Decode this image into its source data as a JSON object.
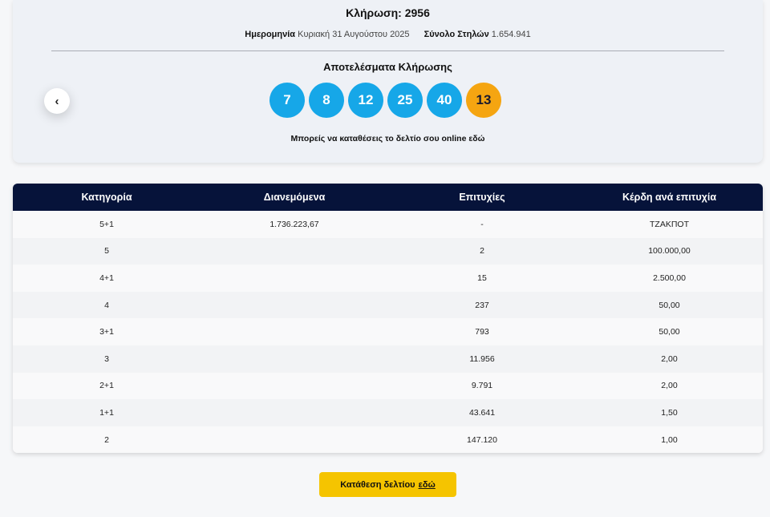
{
  "draw": {
    "title": "Κλήρωση: 2956",
    "date_label": "Ημερομηνία",
    "date_value": "Κυριακή 31 Αυγούστου 2025",
    "columns_label": "Σύνολο Στηλών",
    "columns_value": "1.654.941",
    "results_title": "Αποτελέσματα Κλήρωσης",
    "numbers": [
      "7",
      "8",
      "12",
      "25",
      "40"
    ],
    "joker": "13",
    "online_note": "Μπορείς να καταθέσεις το δελτίο σου online εδώ",
    "prev_icon": "chevron-left-icon",
    "prev_glyph": "‹"
  },
  "colors": {
    "ball": "#16a7e8",
    "joker": "#f5a511",
    "header": "#06133a",
    "button": "#f5c400"
  },
  "table": {
    "headers": [
      "Κατηγορία",
      "Διανεμόμενα",
      "Επιτυχίες",
      "Κέρδη ανά επιτυχία"
    ],
    "rows": [
      [
        "5+1",
        "1.736.223,67",
        "-",
        "ΤΖΑΚΠΟΤ"
      ],
      [
        "5",
        "",
        "2",
        "100.000,00"
      ],
      [
        "4+1",
        "",
        "15",
        "2.500,00"
      ],
      [
        "4",
        "",
        "237",
        "50,00"
      ],
      [
        "3+1",
        "",
        "793",
        "50,00"
      ],
      [
        "3",
        "",
        "11.956",
        "2,00"
      ],
      [
        "2+1",
        "",
        "9.791",
        "2,00"
      ],
      [
        "1+1",
        "",
        "43.641",
        "1,50"
      ],
      [
        "2",
        "",
        "147.120",
        "1,00"
      ]
    ]
  },
  "submit": {
    "label": "Κατάθεση δελτίου",
    "link": "εδώ"
  }
}
